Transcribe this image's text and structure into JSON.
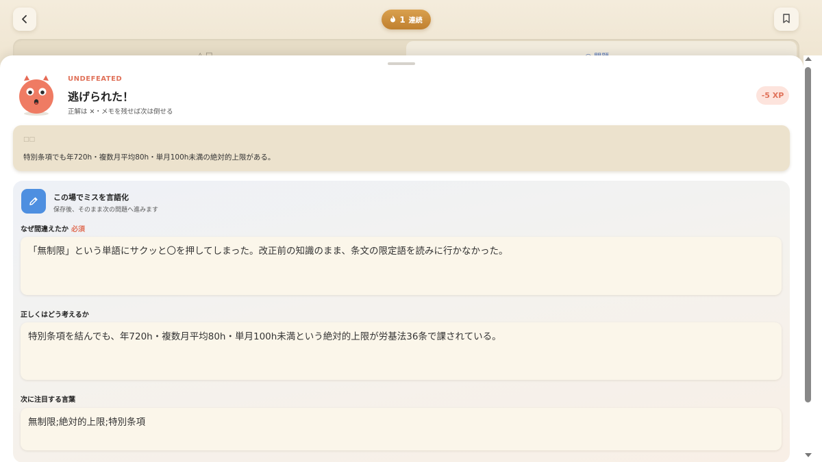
{
  "header": {
    "streak_count": "1",
    "streak_label": "連続"
  },
  "background_tabs": {
    "left_label": "△ □",
    "right_label": "○ 問題"
  },
  "result": {
    "status": "UNDEFEATED",
    "title": "逃げられた！",
    "subtitle": "正解は ✕・メモを残せば次は倒せる",
    "xp": "-5 XP"
  },
  "answer": {
    "label": "□□",
    "text": "特別条項でも年720h・複数月平均80h・単月100h未満の絶対的上限がある。"
  },
  "reflection": {
    "title": "この場でミスを言語化",
    "subtitle": "保存後、そのまま次の問題へ進みます",
    "why_label": "なぜ間違えたか",
    "required_label": "必須",
    "why_value": "「無制限」という単語にサクッと〇を押してしまった。改正前の知識のまま、条文の限定語を読みに行かなかった。",
    "correct_label": "正しくはどう考えるか",
    "correct_value": "特別条項を結んでも、年720h・複数月平均80h・単月100h未満という絶対的上限が労基法36条で課されている。",
    "keywords_label": "次に注目する言葉",
    "keywords_value": "無制限;絶対的上限;特別条項"
  },
  "colors": {
    "accent_orange": "#e0725a",
    "streak_gold": "#c8893a",
    "pencil_blue": "#4e8fe0"
  }
}
